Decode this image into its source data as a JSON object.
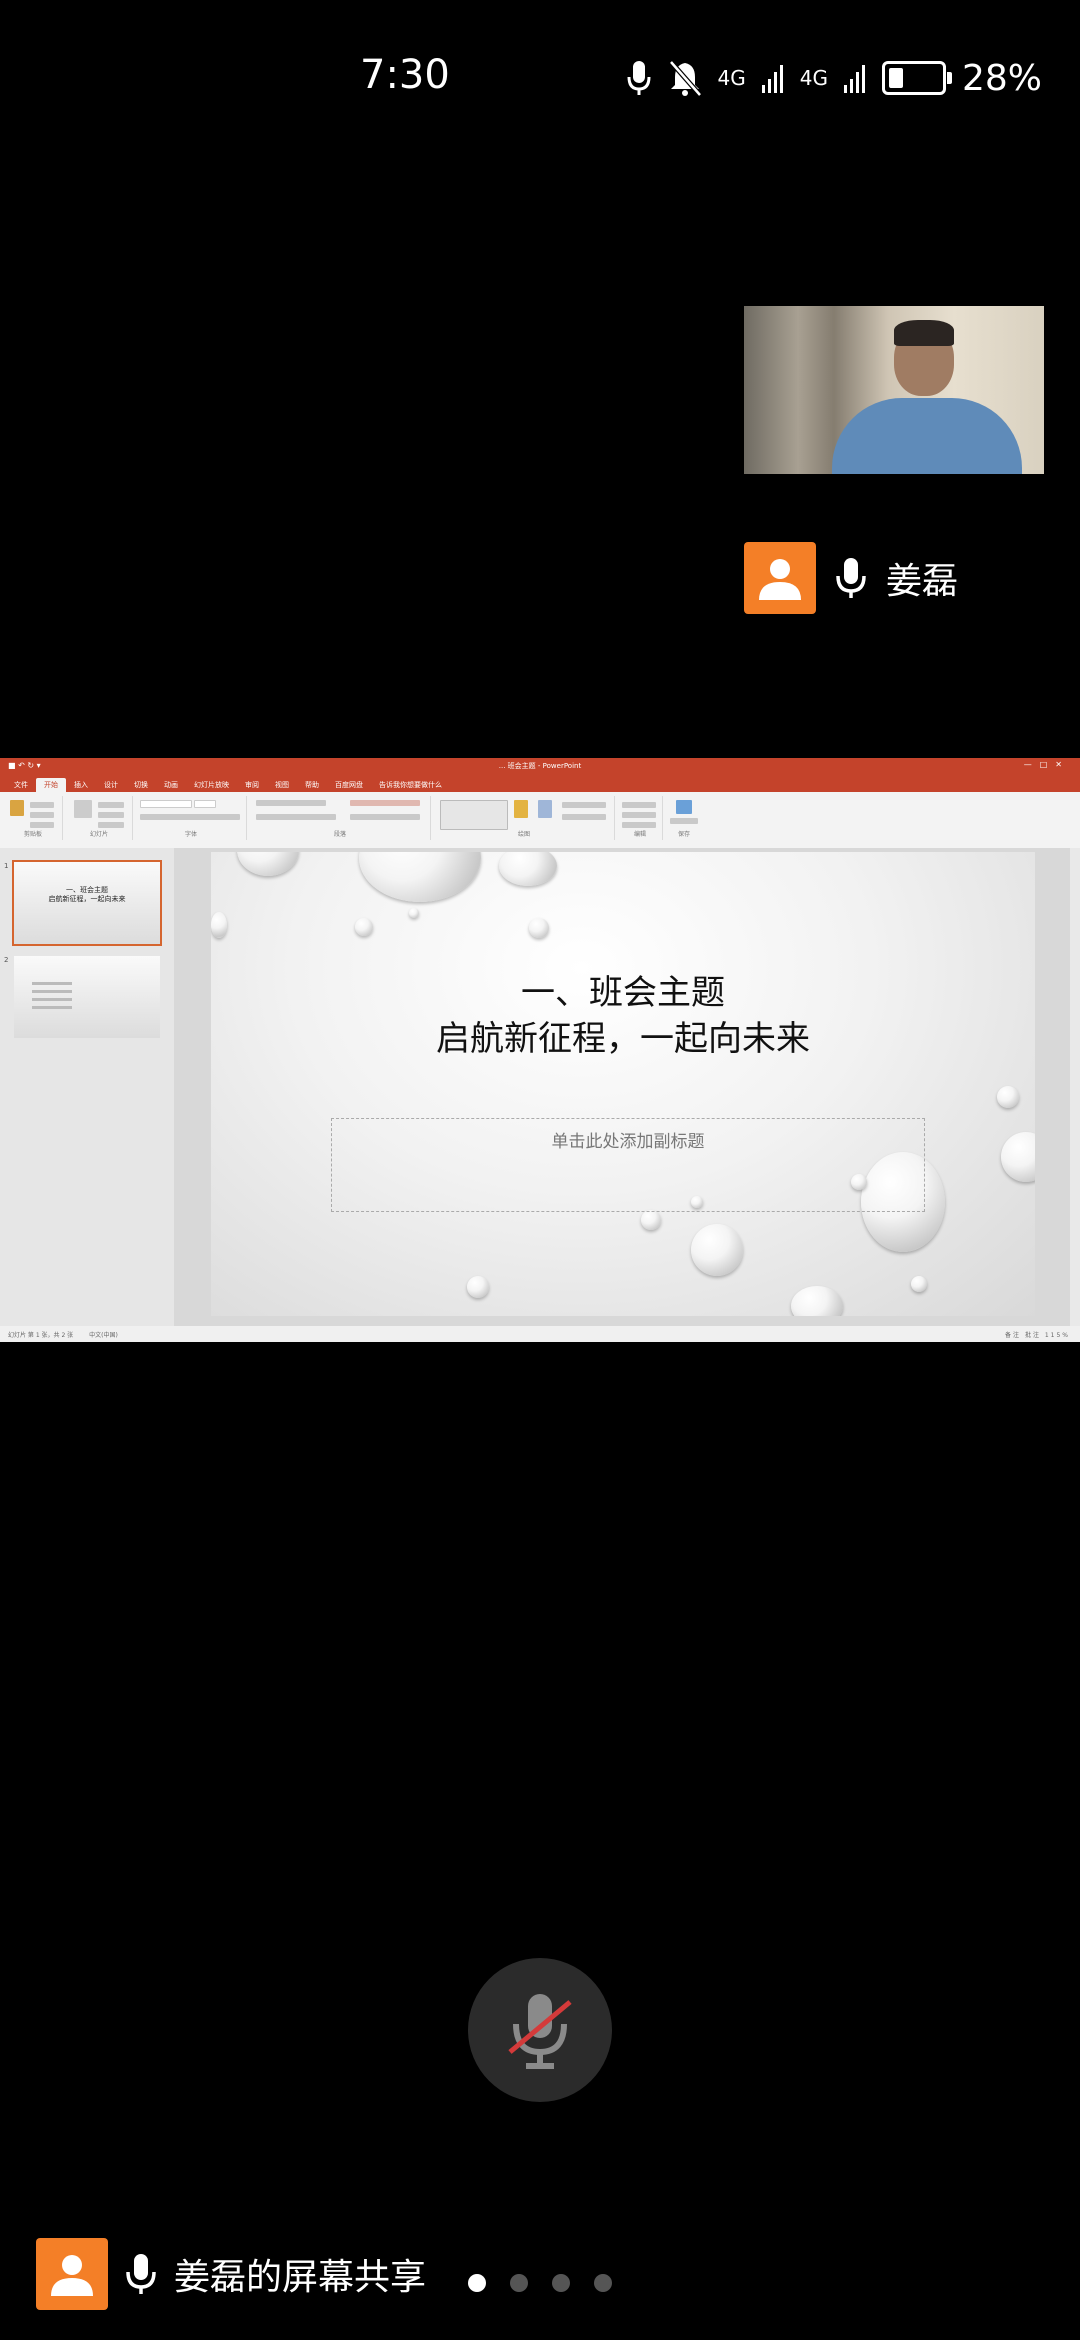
{
  "status_bar": {
    "time": "7:30",
    "signal1": "4G",
    "signal2": "4G",
    "battery": "28%",
    "battery_level": 0.28
  },
  "participant": {
    "name": "姜磊"
  },
  "presentation": {
    "app_title": "... 班会主题 - PowerPoint",
    "tabs": [
      "文件",
      "开始",
      "插入",
      "设计",
      "切换",
      "动画",
      "幻灯片放映",
      "审阅",
      "视图",
      "帮助",
      "百度网盘",
      "告诉我你想要做什么"
    ],
    "active_tab": "开始",
    "ribbon_groups": [
      "剪贴板",
      "幻灯片",
      "字体",
      "段落",
      "绘图",
      "编辑",
      "保存"
    ],
    "slide_title_line1": "一、班会主题",
    "slide_title_line2": "启航新征程，一起向未来",
    "subtitle_placeholder": "单击此处添加副标题",
    "thumb1_text_line1": "一、班会主题",
    "thumb1_text_line2": "启航新征程，一起向未来",
    "status_left": "幻灯片 第 1 张，共 2 张",
    "status_lang": "中文(中国)",
    "status_right": "备注  批注  115%",
    "slide_count": 2
  },
  "controls": {
    "mic_muted": true
  },
  "screen_share": {
    "label": "姜磊的屏幕共享",
    "pages": 4,
    "current_page": 1
  }
}
